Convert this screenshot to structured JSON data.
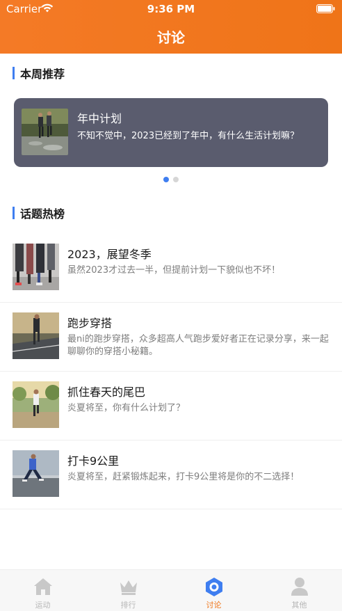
{
  "status_bar": {
    "carrier": "Carrier",
    "time": "9:36 PM"
  },
  "nav": {
    "title": "讨论"
  },
  "weekly": {
    "section_title": "本周推荐",
    "banner": {
      "title": "年中计划",
      "description": "不知不觉中，2023已经到了年中，有什么生活计划嘛？"
    },
    "page_count": 2,
    "active_page": 1
  },
  "hot_topics": {
    "section_title": "话题热榜",
    "items": [
      {
        "title": "2023，展望冬季",
        "description": "虽然2023才过去一半，但提前计划一下貌似也不坏！"
      },
      {
        "title": "跑步穿搭",
        "description": "最ni的跑步穿搭，众多超高人气跑步爱好者正在记录分享，来一起聊聊你的穿搭小秘籍。"
      },
      {
        "title": "抓住春天的尾巴",
        "description": "炎夏将至，你有什么计划了？"
      },
      {
        "title": "打卡9公里",
        "description": "炎夏将至，赶紧锻炼起来，打卡9公里将是你的不二选择！"
      }
    ]
  },
  "tabs": [
    {
      "label": "运动",
      "icon": "home-icon",
      "active": false
    },
    {
      "label": "排行",
      "icon": "crown-icon",
      "active": false
    },
    {
      "label": "讨论",
      "icon": "hexagon-icon",
      "active": true
    },
    {
      "label": "其他",
      "icon": "person-icon",
      "active": false
    }
  ],
  "colors": {
    "accent": "#ef7418",
    "blue": "#3f7ef0",
    "card": "#5a5c6e"
  }
}
